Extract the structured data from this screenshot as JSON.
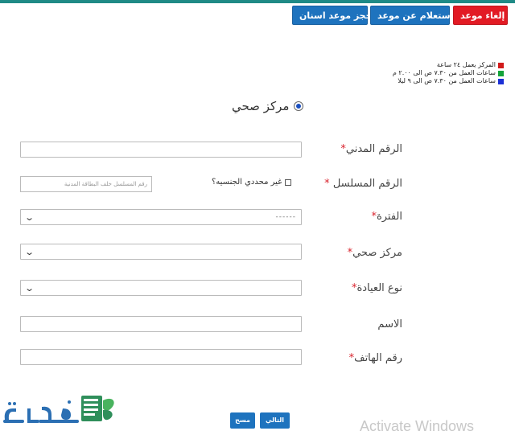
{
  "header": {
    "buttons": [
      {
        "label": "حجز موعد اسنان",
        "color": "#1e73be"
      },
      {
        "label": "استعلام عن موعد",
        "color": "#1e73be"
      },
      {
        "label": "إلغاء موعد",
        "color": "#e21b24"
      }
    ]
  },
  "legend": [
    {
      "text": "المركز يعمل ٢٤ ساعة",
      "color": "#d11a1a"
    },
    {
      "text": "ساعات العمل من ٧.٣٠ ص الى ٢.٠٠ م",
      "color": "#13a33a"
    },
    {
      "text": "ساعات العمل من ٧.٣٠ ص الى ٩ ليلا",
      "color": "#1b2fd6"
    }
  ],
  "radio": {
    "label": "مركز صحي",
    "selected": true
  },
  "form": {
    "civil_id": {
      "label": "الرقم المدني",
      "required_mark": "*"
    },
    "serial": {
      "label": "الرقم المسلسل",
      "required_mark": "*",
      "placeholder": "رقم المسلسل خلف البطاقة المدنية",
      "checkbox_label": "غير محددي الجنسيه؟"
    },
    "period": {
      "label": "الفترة",
      "required_mark": "*",
      "value": "------"
    },
    "health_center": {
      "label": "مركز صحي",
      "required_mark": "*"
    },
    "clinic_type": {
      "label": "نوع العيادة",
      "required_mark": "*"
    },
    "name": {
      "label": "الاسم"
    },
    "phone": {
      "label": "رقم الهاتف",
      "required_mark": "*"
    }
  },
  "actions": {
    "next": "التالي",
    "clear": "مسح"
  },
  "watermark": "Activate Windows",
  "logo": {
    "text": "فكرة"
  }
}
